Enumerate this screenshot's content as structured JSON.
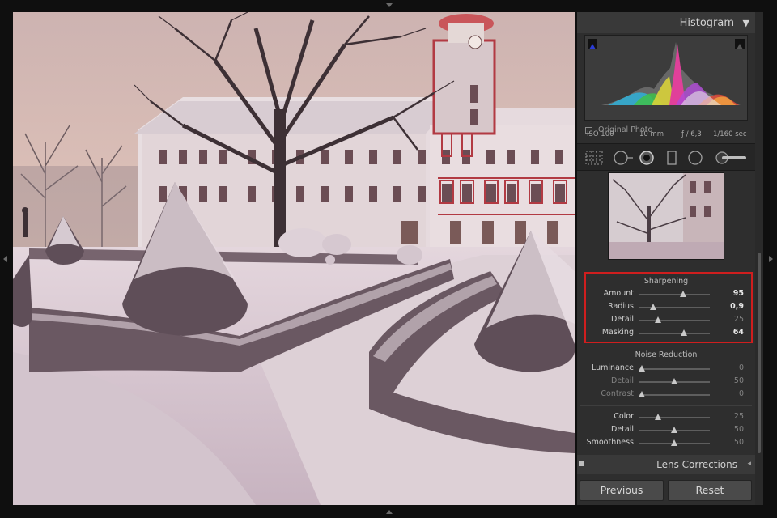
{
  "histogram": {
    "title": "Histogram",
    "toggle_icon": "triangle-down-icon",
    "iso": "ISO 100",
    "focal_length": "10 mm",
    "aperture": "ƒ / 6,3",
    "shutter": "1/160 sec",
    "original_photo_label": "Original Photo"
  },
  "tools": [
    "grid-overlay-icon",
    "crop-tool-icon",
    "spot-removal-icon",
    "graduated-filter-icon",
    "radial-filter-icon",
    "adjustment-brush-icon"
  ],
  "sharpening": {
    "title": "Sharpening",
    "sliders": [
      {
        "label": "Amount",
        "value": "95",
        "position": 0.63
      },
      {
        "label": "Radius",
        "value": "0,9",
        "position": 0.2
      },
      {
        "label": "Detail",
        "value": "25",
        "position": 0.27
      },
      {
        "label": "Masking",
        "value": "64",
        "position": 0.64
      }
    ]
  },
  "noise_reduction": {
    "title": "Noise Reduction",
    "luminance_sliders": [
      {
        "label": "Luminance",
        "value": "0",
        "position": 0.05
      },
      {
        "label": "Detail",
        "value": "50",
        "position": 0.5
      },
      {
        "label": "Contrast",
        "value": "0",
        "position": 0.05
      }
    ],
    "color_sliders": [
      {
        "label": "Color",
        "value": "25",
        "position": 0.27
      },
      {
        "label": "Detail",
        "value": "50",
        "position": 0.5
      },
      {
        "label": "Smoothness",
        "value": "50",
        "position": 0.5
      }
    ]
  },
  "lens_corrections": {
    "title": "Lens Corrections",
    "icon": "collapse-left-icon"
  },
  "buttons": {
    "previous": "Previous",
    "reset": "Reset"
  },
  "colors": {
    "panel_bg": "#2e2e2e",
    "highlight_border": "#cf1e1e",
    "histogram_peak": "#e0409a"
  }
}
